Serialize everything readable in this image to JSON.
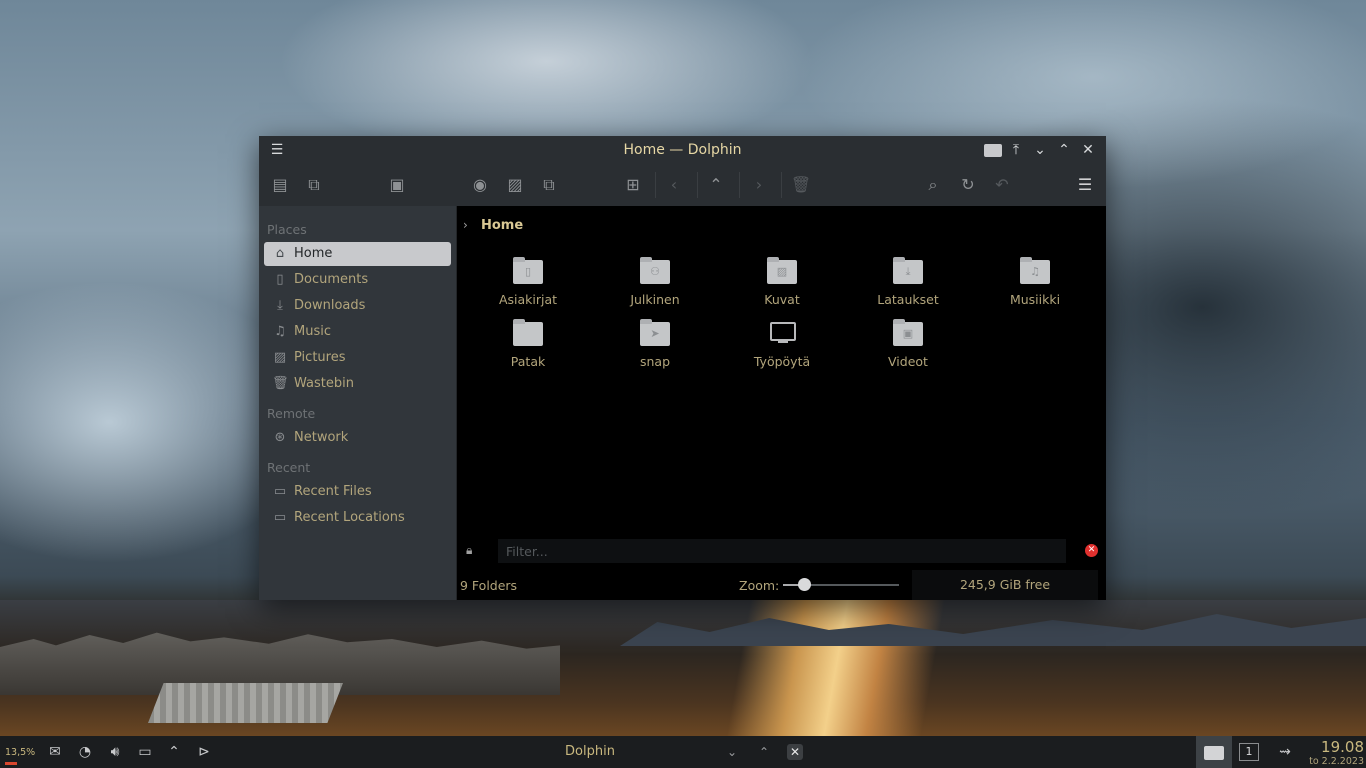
{
  "window": {
    "title": "Home — Dolphin"
  },
  "places": {
    "sections": {
      "places": "Places",
      "remote": "Remote",
      "recent": "Recent"
    },
    "items": [
      {
        "label": "Home",
        "icon": "home-icon",
        "active": true
      },
      {
        "label": "Documents",
        "icon": "documents-icon"
      },
      {
        "label": "Downloads",
        "icon": "downloads-icon"
      },
      {
        "label": "Music",
        "icon": "music-icon"
      },
      {
        "label": "Pictures",
        "icon": "pictures-icon"
      },
      {
        "label": "Wastebin",
        "icon": "wastebin-icon"
      }
    ],
    "remote_items": [
      {
        "label": "Network",
        "icon": "network-icon"
      }
    ],
    "recent_items": [
      {
        "label": "Recent Files",
        "icon": "recent-files-icon"
      },
      {
        "label": "Recent Locations",
        "icon": "recent-locations-icon"
      }
    ]
  },
  "breadcrumb": {
    "current": "Home"
  },
  "files": [
    {
      "name": "Asiakirjat",
      "icon": "folder-documents-icon"
    },
    {
      "name": "Julkinen",
      "icon": "folder-public-icon"
    },
    {
      "name": "Kuvat",
      "icon": "folder-pictures-icon"
    },
    {
      "name": "Lataukset",
      "icon": "folder-downloads-icon"
    },
    {
      "name": "Musiikki",
      "icon": "folder-music-icon"
    },
    {
      "name": "Patak",
      "icon": "folder-icon"
    },
    {
      "name": "snap",
      "icon": "folder-snap-icon"
    },
    {
      "name": "Työpöytä",
      "icon": "desktop-icon"
    },
    {
      "name": "Videot",
      "icon": "folder-videos-icon"
    }
  ],
  "filter": {
    "placeholder": "Filter...",
    "value": ""
  },
  "status": {
    "folders": "9 Folders",
    "zoom_label": "Zoom:",
    "zoom_level": 0.18,
    "free_space": "245,9 GiB free"
  },
  "taskbar": {
    "cpu": "13,5%",
    "active_window": "Dolphin",
    "desktop_number": "1",
    "time": "19.08",
    "date": "to 2.2.2023"
  },
  "colors": {
    "accent_text": "#b2a57c",
    "title_text": "#e6d7a5",
    "active_place_bg": "#c8c9cc",
    "close_red": "#e0302e"
  }
}
